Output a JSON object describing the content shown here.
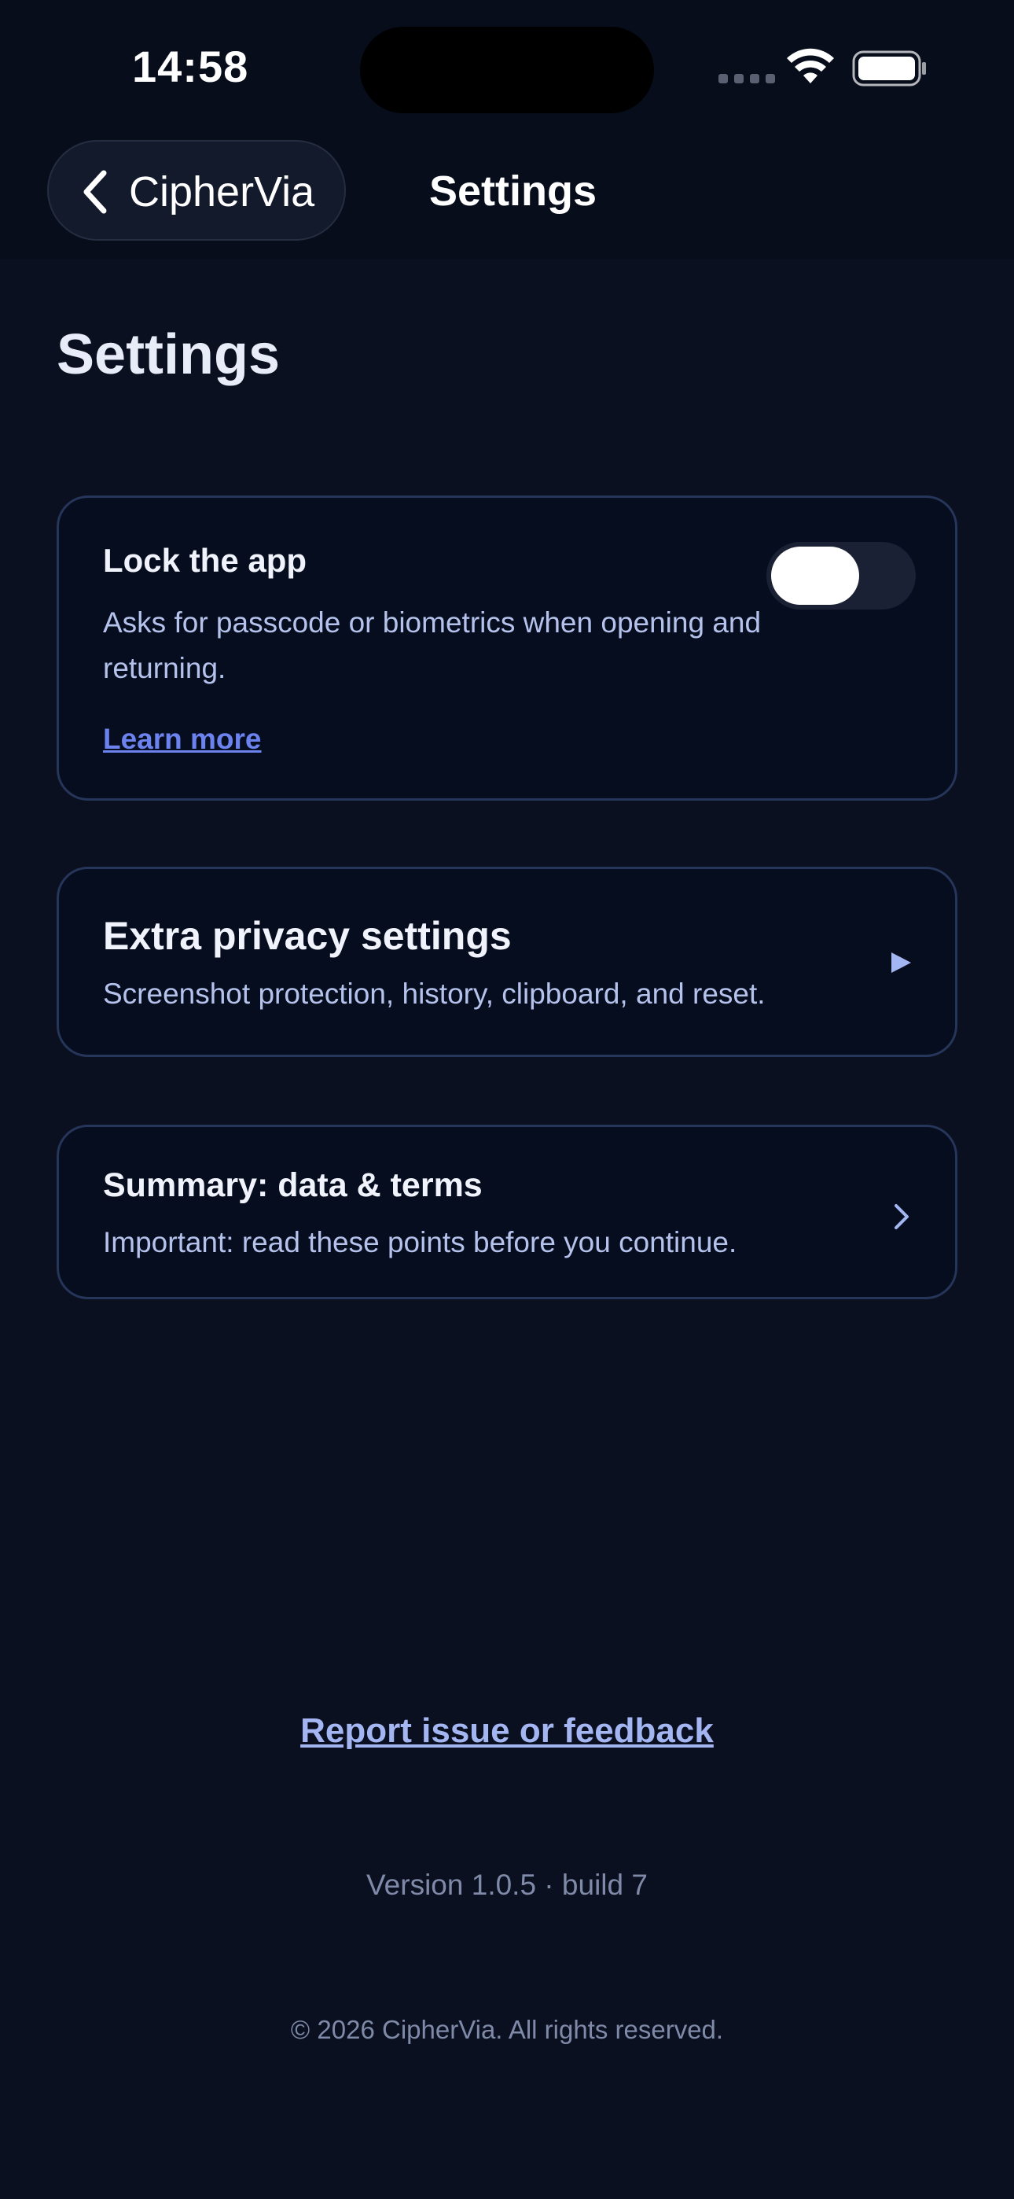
{
  "status_bar": {
    "time": "14:58",
    "icons": [
      "cellular-signal-icon",
      "wifi-icon",
      "battery-icon"
    ]
  },
  "nav": {
    "back_label": "CipherVia",
    "back_icon": "chevron-left-icon",
    "title": "Settings"
  },
  "page": {
    "title": "Settings"
  },
  "lock_card": {
    "title": "Lock the app",
    "description": "Asks for passcode or biometrics when opening and returning.",
    "link": "Learn more",
    "toggle_on": false
  },
  "privacy_card": {
    "title": "Extra privacy settings",
    "description": "Screenshot protection, history, clipboard, and reset.",
    "icon": "play-triangle-icon"
  },
  "summary_card": {
    "title": "Summary: data & terms",
    "description": "Important: read these points before you continue.",
    "icon": "chevron-right-icon"
  },
  "footer": {
    "feedback_link": "Report issue or feedback",
    "version": "Version 1.0.5 · build 7",
    "copyright": "© 2026 CipherVia. All rights reserved."
  },
  "colors": {
    "background": "#0b1020",
    "card_background": "#060d1e",
    "card_border": "#26355a",
    "link_accent": "#6b82ef",
    "feedback_link": "#a4b6f2",
    "secondary_text": "#b4c2ec",
    "muted_text": "#7f8aa8"
  }
}
